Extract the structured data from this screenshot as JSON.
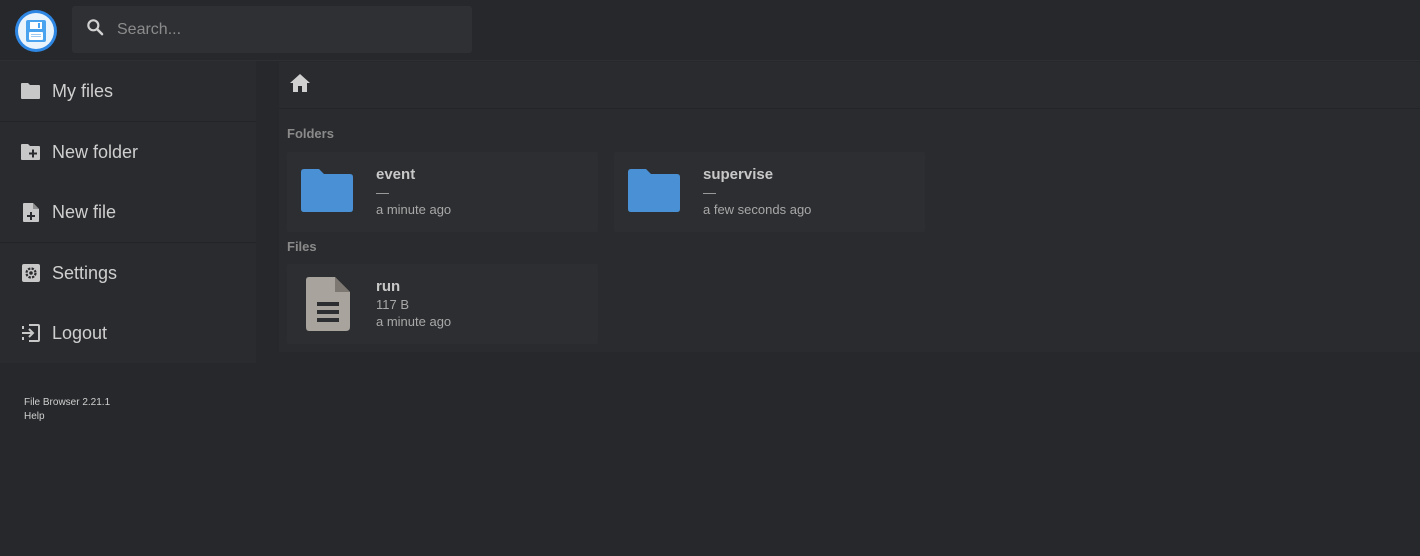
{
  "header": {
    "logo_icon": "floppy-disk-icon",
    "search": {
      "placeholder": "Search...",
      "value": ""
    }
  },
  "sidebar": {
    "items": [
      {
        "label": "My files",
        "icon": "folder-icon"
      },
      {
        "label": "New folder",
        "icon": "create-new-folder-icon"
      },
      {
        "label": "New file",
        "icon": "note-add-icon"
      },
      {
        "label": "Settings",
        "icon": "settings-icon"
      },
      {
        "label": "Logout",
        "icon": "exit-icon"
      }
    ],
    "footer": {
      "version": "File Browser 2.21.1",
      "help": "Help"
    }
  },
  "main": {
    "breadcrumb_icon": "home-icon",
    "folders_title": "Folders",
    "files_title": "Files",
    "folders": [
      {
        "name": "event",
        "size": "—",
        "modified": "a minute ago"
      },
      {
        "name": "supervise",
        "size": "—",
        "modified": "a few seconds ago"
      }
    ],
    "files": [
      {
        "name": "run",
        "size": "117 B",
        "modified": "a minute ago"
      }
    ]
  },
  "colors": {
    "background": "#27282b",
    "panel": "#2a2b2e",
    "card": "#2d2e31",
    "folder": "#4a90d4",
    "file": "#a8a39d",
    "accent": "#2f87e4"
  }
}
